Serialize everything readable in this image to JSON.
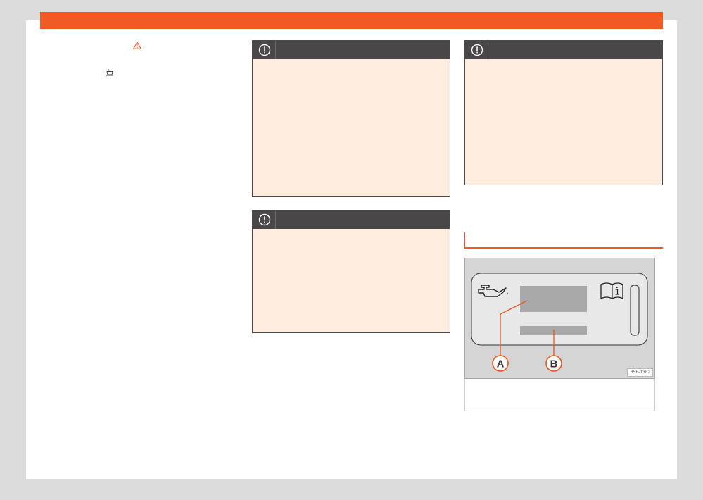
{
  "colors": {
    "accent": "#f15a24",
    "notice_header": "#4a4748",
    "notice_body": "#feecdf",
    "figure_bg": "#d5d5d5"
  },
  "icons": {
    "warning": "warning-triangle-icon",
    "oil_cup": "coffee-cup-icon",
    "notice": "exclamation-circle-icon",
    "oil_can": "oil-can-icon",
    "manual": "manual-info-icon"
  },
  "figure": {
    "code": "B5F-1382",
    "callouts": [
      {
        "label": "A"
      },
      {
        "label": "B"
      }
    ]
  }
}
